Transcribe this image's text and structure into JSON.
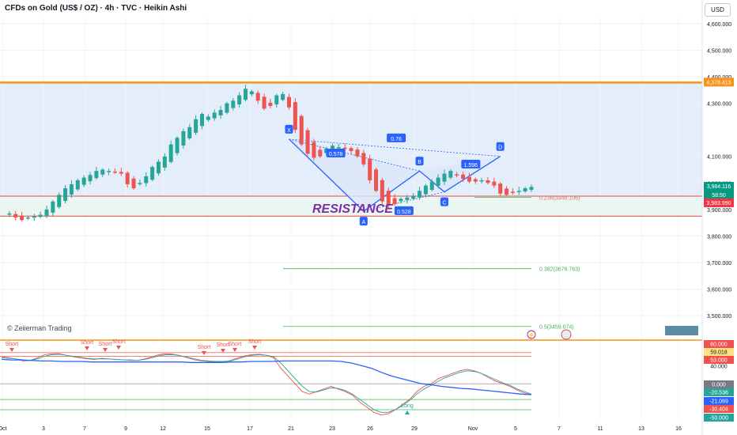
{
  "header": {
    "title": "CFDs on Gold (US$ / OZ) · 4h · TVC · Heikin Ashi",
    "currency_button": "USD"
  },
  "watermark": "© Zeiierman Trading",
  "colors": {
    "up": "#26a69a",
    "down": "#ef5350",
    "resistance_line": "#f7931a",
    "pattern": "#2962ff",
    "pattern_fill": "#dbe6fb",
    "resistance_text": "#7b2fa3",
    "fib_line": "#4caf50"
  },
  "chart_data": [
    {
      "type": "candlestick",
      "x_axis": {
        "tick_labels": [
          "Oct",
          "3",
          "7",
          "9",
          "12",
          "15",
          "17",
          "21",
          "23",
          "26",
          "29",
          "Nov",
          "5",
          "7",
          "11",
          "13",
          "16"
        ]
      },
      "y_axis": {
        "range": [
          3430,
          4700
        ],
        "tick_labels": [
          "4,600.000",
          "4,500.000",
          "4,400.000",
          "4,300.000",
          "4,100.000",
          "4,000.000",
          "3,900.000",
          "3,800.000",
          "3,700.000",
          "3,600.000",
          "3,500.000"
        ]
      },
      "price_badges": [
        {
          "value": "4,378.413",
          "kind": "resistance"
        },
        {
          "value": "3,984.116",
          "kind": "last"
        },
        {
          "value": "58:50",
          "kind": "countdown"
        },
        {
          "value": "3,983.990",
          "kind": "close"
        }
      ],
      "resistance_level": 4378.413,
      "resistance_zone": [
        3875,
        3950
      ],
      "resistance_label": "RESISTANCE",
      "pattern": {
        "points": [
          {
            "label": "X",
            "price": 4165
          },
          {
            "label": "A",
            "price": 3893
          },
          {
            "label": "B",
            "price": 4045
          },
          {
            "label": "C",
            "price": 3966
          },
          {
            "label": "D",
            "price": 4100
          }
        ],
        "ratios": [
          "0.578",
          "0.76",
          "1.596",
          "0.528"
        ]
      },
      "fib_levels": [
        {
          "label": "0.236(3946.106)",
          "value": 3946.106
        },
        {
          "label": "0.382(3676.763)",
          "value": 3676.763
        },
        {
          "label": "0.5(3459.074)",
          "value": 3459.074
        }
      ],
      "close_series": [
        3880,
        3885,
        3870,
        3860,
        3870,
        3875,
        3880,
        3900,
        3930,
        3955,
        3980,
        3995,
        4010,
        4020,
        4030,
        4045,
        4050,
        4045,
        4040,
        4035,
        3995,
        3980,
        4000,
        4025,
        4060,
        4080,
        4100,
        4145,
        4170,
        4195,
        4210,
        4240,
        4260,
        4250,
        4265,
        4275,
        4300,
        4310,
        4330,
        4355,
        4345,
        4310,
        4280,
        4290,
        4330,
        4335,
        4285,
        4200,
        4145,
        4110,
        4095,
        4100,
        4130,
        4140,
        4135,
        4130,
        4120,
        4100,
        4070,
        4010,
        3970,
        3930,
        3915,
        3920,
        3940,
        3945,
        3950,
        3970,
        3990,
        4005,
        4020,
        4035,
        4045,
        4030,
        4015,
        4005,
        4005,
        4010,
        4000,
        3990,
        3960,
        3955,
        3965,
        3970,
        3980,
        3985
      ],
      "visible_index_range": [
        0,
        85
      ]
    },
    {
      "type": "line",
      "subtype": "oscillator",
      "signal_labels": [
        "Short",
        "Short",
        "Short",
        "Short",
        "Short",
        "Short",
        "Short",
        "Short",
        "Long"
      ],
      "y_axis": {
        "tick_labels": [
          "60.000",
          "59.018",
          "53.000",
          "40.000",
          "0.000",
          "-20.536",
          "-21.069",
          "-30.404",
          "-50.000"
        ]
      },
      "levels": [
        60,
        53,
        0,
        -30.404,
        -50
      ],
      "series": [
        {
          "values": [
            52,
            50,
            48,
            44,
            45,
            50,
            56,
            58,
            58,
            55,
            52,
            50,
            48,
            47,
            49,
            48,
            47,
            46,
            45,
            45,
            48,
            52,
            56,
            58,
            57,
            54,
            50,
            46,
            44,
            43,
            42,
            42,
            45,
            50,
            54,
            56,
            57,
            55,
            50,
            30,
            15,
            0,
            -15,
            -20,
            -15,
            -10,
            -5,
            -10,
            -15,
            -22,
            -35,
            -45,
            -55,
            -60,
            -58,
            -50,
            -40,
            -30,
            -15,
            -5,
            0,
            10,
            15,
            20,
            25,
            28,
            25,
            20,
            12,
            5,
            0,
            -5,
            -12,
            -18,
            -21
          ]
        },
        {
          "values": [
            50,
            49,
            48,
            46,
            45,
            48,
            53,
            56,
            57,
            55,
            53,
            51,
            49,
            48,
            48,
            48,
            47,
            46,
            46,
            45,
            47,
            50,
            54,
            56,
            56,
            54,
            51,
            48,
            45,
            44,
            43,
            43,
            44,
            48,
            52,
            55,
            56,
            55,
            52,
            40,
            25,
            10,
            -5,
            -15,
            -16,
            -12,
            -8,
            -9,
            -13,
            -20,
            -30,
            -40,
            -50,
            -55,
            -55,
            -50,
            -42,
            -32,
            -20,
            -10,
            -3,
            5,
            12,
            17,
            22,
            25,
            24,
            20,
            14,
            8,
            2,
            -3,
            -10,
            -15,
            -20
          ]
        },
        {
          "values": [
            47,
            46,
            46,
            45,
            44,
            44,
            43,
            43,
            43,
            42,
            42,
            42,
            42,
            42,
            42,
            42,
            42,
            42,
            42,
            41,
            41,
            41,
            41,
            42,
            42,
            43,
            43,
            43,
            44,
            44,
            44,
            44,
            44,
            44,
            43,
            40,
            35,
            30,
            22,
            15,
            10,
            5,
            0,
            -2,
            -5,
            -7,
            -9,
            -10,
            -12,
            -14,
            -16,
            -18,
            -20,
            -21
          ]
        }
      ]
    }
  ]
}
